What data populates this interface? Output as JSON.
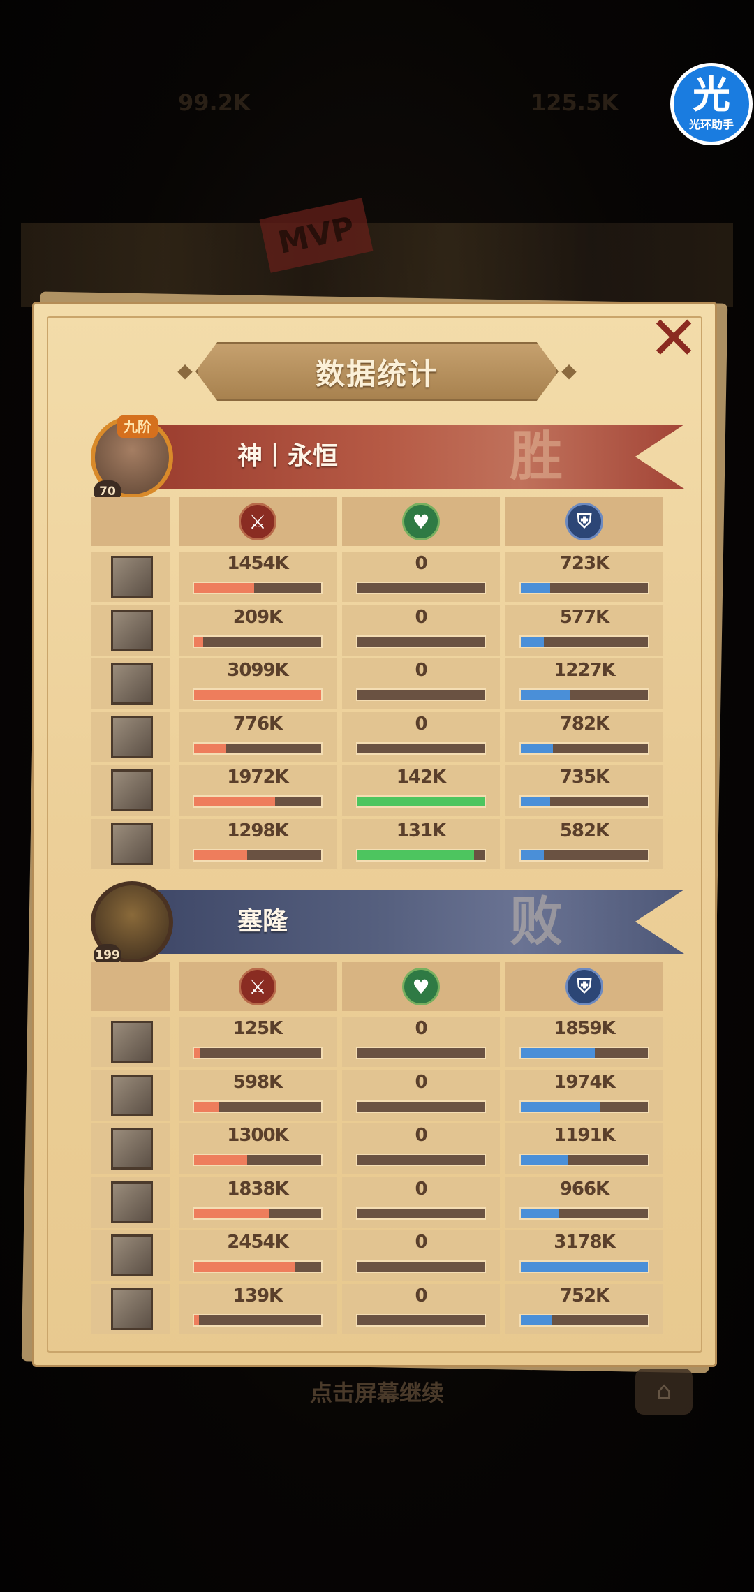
{
  "background": {
    "top_left_text": "99.2K",
    "top_right_text": "125.5K",
    "mvp_label": "MVP"
  },
  "helper": {
    "glyph": "光",
    "caption": "光环助手"
  },
  "panel": {
    "title": "数据统计",
    "close_glyph": "✕"
  },
  "stat_icons": {
    "damage": "sword-icon",
    "healing": "heart-plus-icon",
    "tanked": "shield-icon"
  },
  "teams": [
    {
      "name": "神丨永恒",
      "result": "胜",
      "level": "70",
      "vip": "九阶",
      "heroes": [
        {
          "damage": "1454K",
          "damage_pct": 0.47,
          "healing": "0",
          "healing_pct": 0,
          "tanked": "723K",
          "tanked_pct": 0.23
        },
        {
          "damage": "209K",
          "damage_pct": 0.07,
          "healing": "0",
          "healing_pct": 0,
          "tanked": "577K",
          "tanked_pct": 0.18
        },
        {
          "damage": "3099K",
          "damage_pct": 1.0,
          "healing": "0",
          "healing_pct": 0,
          "tanked": "1227K",
          "tanked_pct": 0.39
        },
        {
          "damage": "776K",
          "damage_pct": 0.25,
          "healing": "0",
          "healing_pct": 0,
          "tanked": "782K",
          "tanked_pct": 0.25
        },
        {
          "damage": "1972K",
          "damage_pct": 0.64,
          "healing": "142K",
          "healing_pct": 1.0,
          "tanked": "735K",
          "tanked_pct": 0.23
        },
        {
          "damage": "1298K",
          "damage_pct": 0.42,
          "healing": "131K",
          "healing_pct": 0.92,
          "tanked": "582K",
          "tanked_pct": 0.18
        }
      ]
    },
    {
      "name": "塞隆",
      "result": "败",
      "level": "199",
      "heroes": [
        {
          "damage": "125K",
          "damage_pct": 0.05,
          "healing": "0",
          "healing_pct": 0,
          "tanked": "1859K",
          "tanked_pct": 0.58
        },
        {
          "damage": "598K",
          "damage_pct": 0.19,
          "healing": "0",
          "healing_pct": 0,
          "tanked": "1974K",
          "tanked_pct": 0.62
        },
        {
          "damage": "1300K",
          "damage_pct": 0.42,
          "healing": "0",
          "healing_pct": 0,
          "tanked": "1191K",
          "tanked_pct": 0.37
        },
        {
          "damage": "1838K",
          "damage_pct": 0.59,
          "healing": "0",
          "healing_pct": 0,
          "tanked": "966K",
          "tanked_pct": 0.3
        },
        {
          "damage": "2454K",
          "damage_pct": 0.79,
          "healing": "0",
          "healing_pct": 0,
          "tanked": "3178K",
          "tanked_pct": 1.0
        },
        {
          "damage": "139K",
          "damage_pct": 0.04,
          "healing": "0",
          "healing_pct": 0,
          "tanked": "752K",
          "tanked_pct": 0.24
        }
      ]
    }
  ],
  "footer": {
    "continue_text": "点击屏幕继续",
    "share_glyph": "⌂"
  }
}
